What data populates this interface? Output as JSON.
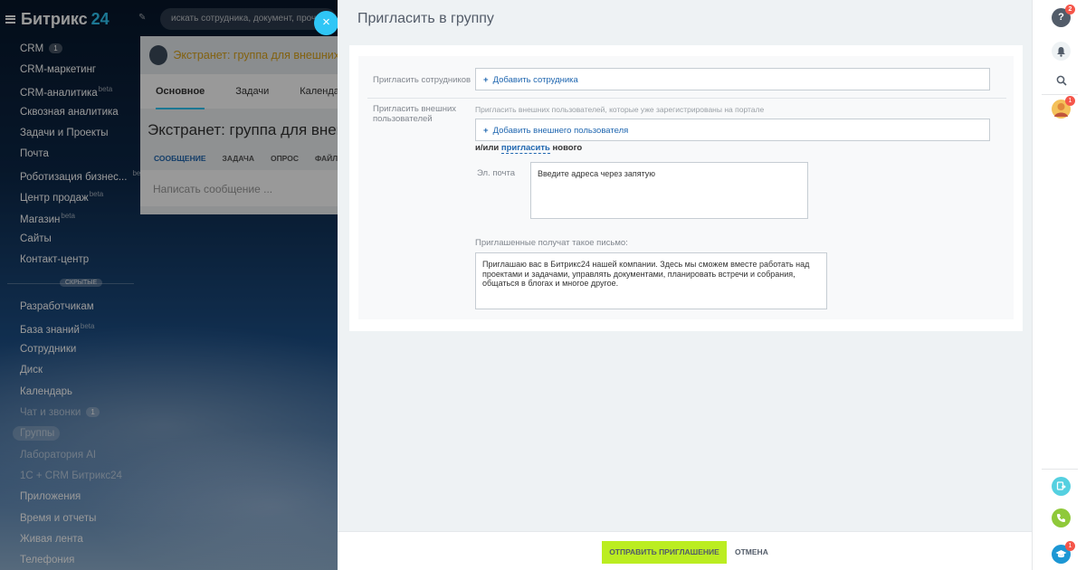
{
  "app": {
    "logo_name": "Битрикс",
    "logo_num": "24"
  },
  "search": {
    "placeholder": "искать сотрудника, документ, прочее"
  },
  "left_menu": {
    "items": [
      {
        "label": "CRM",
        "counter": "1"
      },
      {
        "label": "CRM-маркетинг"
      },
      {
        "label": "CRM-аналитика",
        "sup": "beta"
      },
      {
        "label": "Сквозная аналитика"
      },
      {
        "label": "Задачи и Проекты"
      },
      {
        "label": "Почта"
      },
      {
        "label": "Роботизация бизнес...",
        "sup": "beta"
      },
      {
        "label": "Центр продаж",
        "sup": "beta"
      },
      {
        "label": "Магазин",
        "sup": "beta"
      },
      {
        "label": "Сайты"
      },
      {
        "label": "Контакт-центр"
      }
    ],
    "hidden_label": "скрытые",
    "hidden_items": [
      {
        "label": "Разработчикам"
      },
      {
        "label": "База знаний",
        "sup": "beta"
      },
      {
        "label": "Сотрудники"
      },
      {
        "label": "Диск"
      },
      {
        "label": "Календарь"
      },
      {
        "label": "Чат и звонки",
        "counter": "1"
      },
      {
        "label": "Группы"
      },
      {
        "label": "Лаборатория AI"
      },
      {
        "label": "1С + CRM Битрикс24"
      },
      {
        "label": "Приложения"
      },
      {
        "label": "Время и отчеты"
      },
      {
        "label": "Живая лента"
      },
      {
        "label": "Телефония"
      }
    ]
  },
  "workarea": {
    "group_header": "Экстранет: группа для внешних",
    "tabs": [
      "Основное",
      "Задачи",
      "Календарь"
    ],
    "group_title": "Экстранет: группа для внешних",
    "post_tabs": [
      "СООБЩЕНИЕ",
      "ЗАДАЧА",
      "ОПРОС",
      "ФАЙЛ"
    ],
    "post_placeholder": "Написать сообщение ..."
  },
  "slider": {
    "close_symbol": "×",
    "title": "Пригласить в группу",
    "invite_employees_label": "Пригласить сотрудников",
    "add_employee": "Добавить сотрудника",
    "invite_external_label": "Пригласить внешних пользователей",
    "external_hint": "Пригласить внешних пользователей, которые уже зарегистрированы на портале",
    "add_external": "Добавить внешнего пользователя",
    "or_prefix": "и/или",
    "invite_link": "пригласить",
    "or_suffix": "нового",
    "email_label": "Эл. почта",
    "email_placeholder": "Введите адреса через запятую",
    "letter_label": "Приглашенные получат такое письмо:",
    "letter_text": "Приглашаю вас в Битрикс24 нашей компании. Здесь мы сможем вместе работать над проектами и задачами, управлять документами, планировать встречи и собрания, общаться в блогах и многое другое.",
    "send_button": "ОТПРАВИТЬ ПРИГЛАШЕНИЕ",
    "cancel_button": "ОТМЕНА"
  },
  "right_bar": {
    "help_badge": "2",
    "avatar_badge": "1",
    "academy_badge": "1"
  },
  "colors": {
    "accent": "#2fc6f6",
    "send_button": "#bbed21",
    "link": "#2067b0",
    "badge": "#f5564a"
  }
}
